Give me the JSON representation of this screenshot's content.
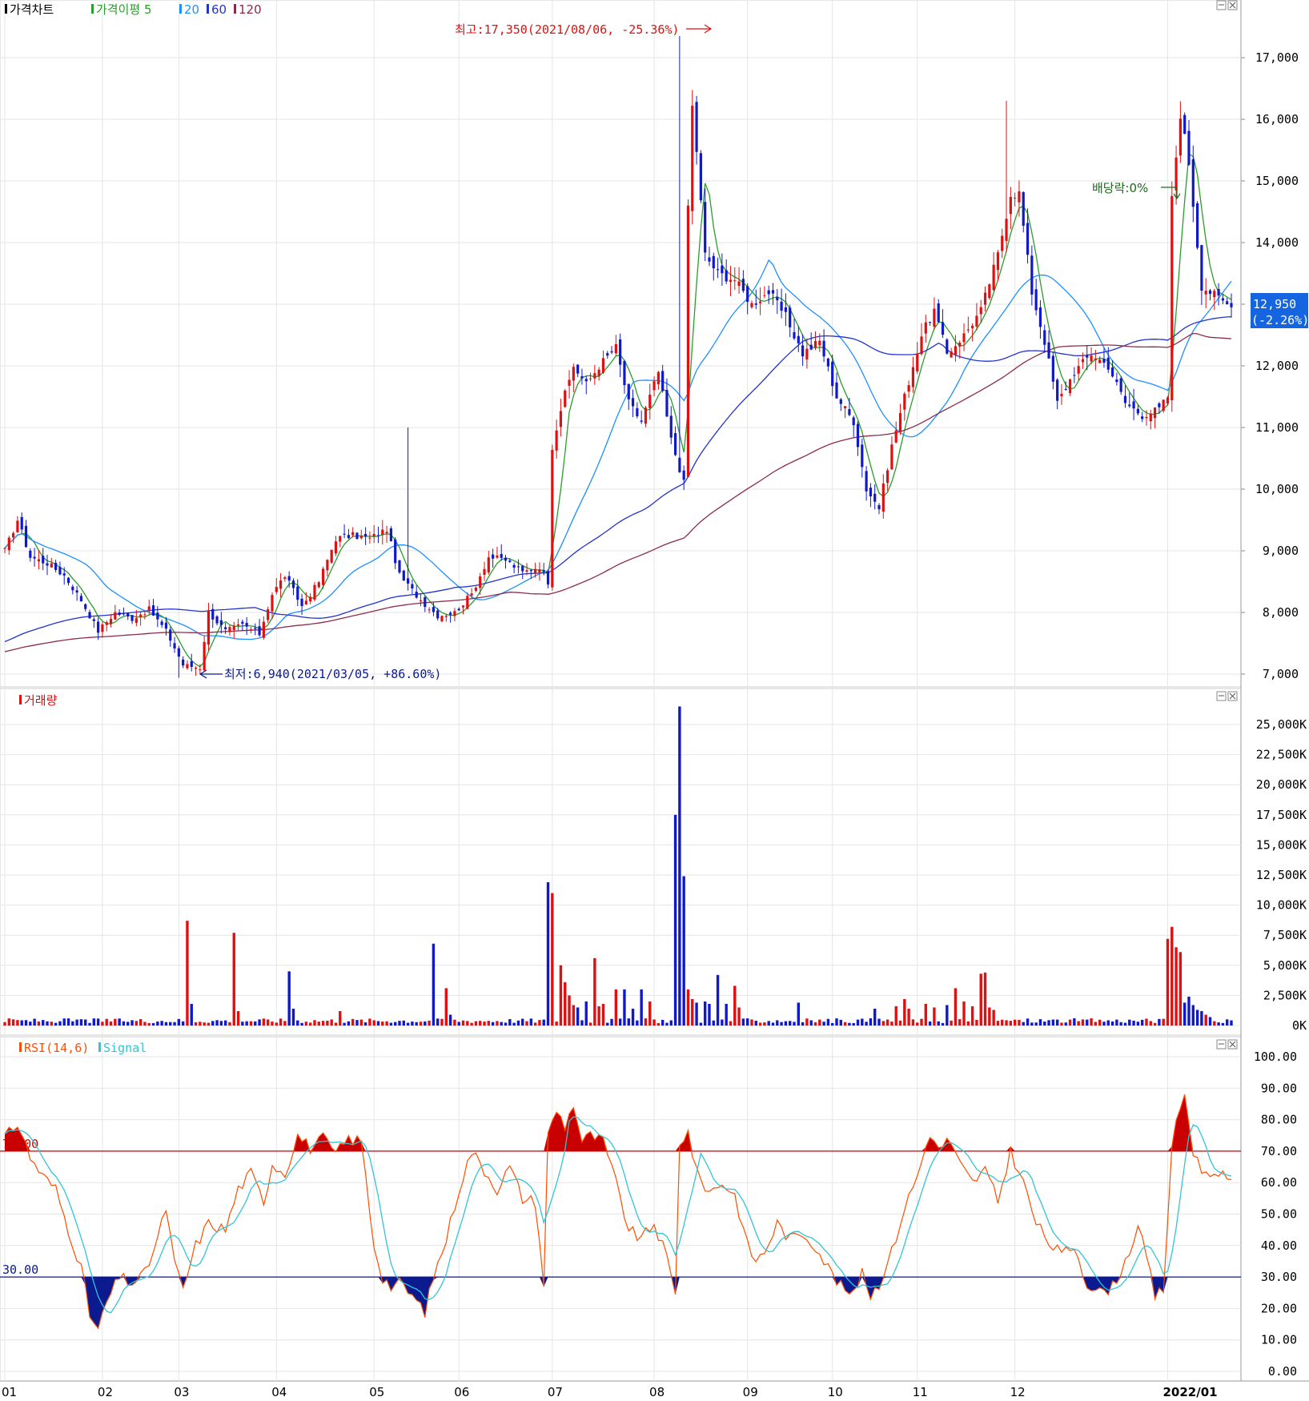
{
  "chart_data": [
    {
      "type": "candlestick",
      "legend": [
        {
          "label": "가격차트",
          "color": "#000000"
        },
        {
          "label": "가격이평 5",
          "color": "#2a9d2a"
        },
        {
          "label": "20",
          "color": "#1e90ff"
        },
        {
          "label": "60",
          "color": "#2233cc"
        },
        {
          "label": "120",
          "color": "#8b2b4a"
        }
      ],
      "ylim": [
        6600,
        17900
      ],
      "y_ticks": [
        "17,000",
        "16,000",
        "15,000",
        "14,000",
        "13,000",
        "12,000",
        "11,000",
        "10,000",
        "9,000",
        "8,000",
        "7,000"
      ],
      "y_tick_values": [
        17000,
        16000,
        15000,
        14000,
        13000,
        12000,
        11000,
        10000,
        9000,
        8000,
        7000
      ],
      "current_price": {
        "label": "12,950",
        "change": "(-2.26%)",
        "value": 12950
      },
      "annotations": [
        {
          "text": "최고:17,350(2021/08/06, -25.36%)",
          "value": 17350,
          "date": "2021/08/06"
        },
        {
          "text": "최저:6,940(2021/03/05, +86.60%)",
          "value": 6940,
          "date": "2021/03/05"
        },
        {
          "text": "배당락:0%",
          "date": "2021/12/29"
        }
      ],
      "price_anchors": [
        [
          0,
          9000
        ],
        [
          3,
          9500
        ],
        [
          6,
          8900
        ],
        [
          10,
          8800
        ],
        [
          14,
          8600
        ],
        [
          18,
          8200
        ],
        [
          22,
          7700
        ],
        [
          26,
          8000
        ],
        [
          30,
          7900
        ],
        [
          34,
          8050
        ],
        [
          38,
          7700
        ],
        [
          42,
          7150
        ],
        [
          46,
          7100
        ],
        [
          48,
          8000
        ],
        [
          52,
          7700
        ],
        [
          56,
          7800
        ],
        [
          60,
          7650
        ],
        [
          63,
          8300
        ],
        [
          66,
          8600
        ],
        [
          70,
          8100
        ],
        [
          74,
          8500
        ],
        [
          78,
          9200
        ],
        [
          82,
          9250
        ],
        [
          86,
          9200
        ],
        [
          90,
          9350
        ],
        [
          93,
          8600
        ],
        [
          98,
          8200
        ],
        [
          102,
          7950
        ],
        [
          106,
          8000
        ],
        [
          110,
          8300
        ],
        [
          114,
          8900
        ],
        [
          118,
          8850
        ],
        [
          122,
          8650
        ],
        [
          126,
          8750
        ],
        [
          128,
          8500
        ],
        [
          129,
          10700
        ],
        [
          131,
          11300
        ],
        [
          134,
          12000
        ],
        [
          137,
          11700
        ],
        [
          140,
          12000
        ],
        [
          144,
          12300
        ],
        [
          147,
          11400
        ],
        [
          150,
          11100
        ],
        [
          154,
          11900
        ],
        [
          157,
          10800
        ],
        [
          160,
          10100
        ],
        [
          161,
          14600
        ],
        [
          162,
          16200
        ],
        [
          163,
          15500
        ],
        [
          165,
          13800
        ],
        [
          168,
          13500
        ],
        [
          172,
          13400
        ],
        [
          176,
          13000
        ],
        [
          180,
          13200
        ],
        [
          184,
          12800
        ],
        [
          188,
          12200
        ],
        [
          192,
          12400
        ],
        [
          196,
          11500
        ],
        [
          200,
          11100
        ],
        [
          203,
          10000
        ],
        [
          206,
          9700
        ],
        [
          209,
          10700
        ],
        [
          212,
          11500
        ],
        [
          216,
          12500
        ],
        [
          219,
          12900
        ],
        [
          222,
          12200
        ],
        [
          226,
          12500
        ],
        [
          230,
          12900
        ],
        [
          234,
          13800
        ],
        [
          237,
          14800
        ],
        [
          239,
          14800
        ],
        [
          242,
          13200
        ],
        [
          245,
          12400
        ],
        [
          248,
          11400
        ],
        [
          252,
          11900
        ],
        [
          256,
          12200
        ],
        [
          260,
          12000
        ],
        [
          264,
          11400
        ],
        [
          268,
          11200
        ],
        [
          272,
          11300
        ],
        [
          274,
          11500
        ],
        [
          275,
          14700
        ],
        [
          277,
          16100
        ],
        [
          279,
          15300
        ],
        [
          282,
          13300
        ],
        [
          286,
          13100
        ],
        [
          289,
          12950
        ]
      ],
      "month_ticks": [
        {
          "label": "01",
          "index": 0
        },
        {
          "label": "02",
          "index": 23
        },
        {
          "label": "03",
          "index": 41
        },
        {
          "label": "04",
          "index": 64
        },
        {
          "label": "05",
          "index": 87
        },
        {
          "label": "06",
          "index": 107
        },
        {
          "label": "07",
          "index": 129
        },
        {
          "label": "08",
          "index": 153
        },
        {
          "label": "09",
          "index": 175
        },
        {
          "label": "10",
          "index": 195
        },
        {
          "label": "11",
          "index": 215
        },
        {
          "label": "12",
          "index": 238
        },
        {
          "label": "2022/01",
          "index": 274
        }
      ],
      "total_days": 290
    },
    {
      "type": "bar",
      "legend": [
        {
          "label": "거래량",
          "color": "#dd1111"
        }
      ],
      "ylim": [
        0,
        26500
      ],
      "y_ticks": [
        "25,000K",
        "22,500K",
        "20,000K",
        "17,500K",
        "15,000K",
        "12,500K",
        "10,000K",
        "7,500K",
        "5,000K",
        "2,500K",
        "0K"
      ],
      "y_tick_values": [
        25000,
        22500,
        20000,
        17500,
        15000,
        12500,
        10000,
        7500,
        5000,
        2500,
        0
      ],
      "base_volume": 400,
      "volume_spikes": [
        [
          43,
          8700
        ],
        [
          44,
          1800
        ],
        [
          54,
          7700
        ],
        [
          55,
          1200
        ],
        [
          67,
          4500
        ],
        [
          68,
          1400
        ],
        [
          79,
          1200
        ],
        [
          101,
          6800
        ],
        [
          104,
          3100
        ],
        [
          105,
          900
        ],
        [
          128,
          11900
        ],
        [
          129,
          11000
        ],
        [
          131,
          5000
        ],
        [
          132,
          3600
        ],
        [
          133,
          2500
        ],
        [
          134,
          1700
        ],
        [
          135,
          1500
        ],
        [
          137,
          2000
        ],
        [
          139,
          5600
        ],
        [
          140,
          1600
        ],
        [
          141,
          1800
        ],
        [
          144,
          3000
        ],
        [
          146,
          3000
        ],
        [
          148,
          1400
        ],
        [
          150,
          3000
        ],
        [
          152,
          2000
        ],
        [
          158,
          17500
        ],
        [
          159,
          26500
        ],
        [
          160,
          12400
        ],
        [
          161,
          3000
        ],
        [
          162,
          2200
        ],
        [
          163,
          1900
        ],
        [
          165,
          2000
        ],
        [
          166,
          1800
        ],
        [
          168,
          4200
        ],
        [
          170,
          1800
        ],
        [
          172,
          3300
        ],
        [
          173,
          1500
        ],
        [
          187,
          1900
        ],
        [
          205,
          1400
        ],
        [
          210,
          1600
        ],
        [
          212,
          2200
        ],
        [
          213,
          1400
        ],
        [
          217,
          1800
        ],
        [
          219,
          1500
        ],
        [
          222,
          1700
        ],
        [
          224,
          3100
        ],
        [
          226,
          2000
        ],
        [
          228,
          1600
        ],
        [
          230,
          4300
        ],
        [
          231,
          4400
        ],
        [
          232,
          1500
        ],
        [
          233,
          1300
        ],
        [
          274,
          7200
        ],
        [
          275,
          8200
        ],
        [
          276,
          6500
        ],
        [
          277,
          6100
        ],
        [
          278,
          1900
        ],
        [
          279,
          2400
        ],
        [
          280,
          1700
        ],
        [
          281,
          1300
        ],
        [
          282,
          1200
        ],
        [
          283,
          900
        ],
        [
          284,
          700
        ]
      ]
    },
    {
      "type": "line",
      "legend": [
        {
          "label": "RSI(14,6)",
          "color": "#ff4d00"
        },
        {
          "label": "Signal",
          "color": "#33c4d4"
        }
      ],
      "ylim": [
        0,
        100
      ],
      "y_ticks": [
        "100.00",
        "90.00",
        "80.00",
        "70.00",
        "60.00",
        "50.00",
        "40.00",
        "30.00",
        "20.00",
        "10.00",
        "0.00"
      ],
      "y_tick_values": [
        100,
        90,
        80,
        70,
        60,
        50,
        40,
        30,
        20,
        10,
        0
      ],
      "levels": [
        {
          "label": "70.00",
          "value": 70,
          "color": "#cc0000"
        },
        {
          "label": "30.00",
          "value": 30,
          "color": "#0b1a8f"
        }
      ],
      "rsi_anchors": [
        [
          0,
          74
        ],
        [
          3,
          79
        ],
        [
          6,
          68
        ],
        [
          9,
          62
        ],
        [
          12,
          58
        ],
        [
          15,
          45
        ],
        [
          18,
          33
        ],
        [
          20,
          18
        ],
        [
          22,
          13
        ],
        [
          24,
          22
        ],
        [
          27,
          30
        ],
        [
          30,
          28
        ],
        [
          33,
          31
        ],
        [
          36,
          42
        ],
        [
          38,
          52
        ],
        [
          40,
          34
        ],
        [
          42,
          26
        ],
        [
          45,
          40
        ],
        [
          48,
          47
        ],
        [
          52,
          45
        ],
        [
          55,
          58
        ],
        [
          58,
          63
        ],
        [
          61,
          54
        ],
        [
          63,
          66
        ],
        [
          66,
          63
        ],
        [
          69,
          75
        ],
        [
          72,
          71
        ],
        [
          75,
          74
        ],
        [
          78,
          69
        ],
        [
          81,
          74
        ],
        [
          84,
          73
        ],
        [
          87,
          40
        ],
        [
          89,
          30
        ],
        [
          91,
          27
        ],
        [
          93,
          28
        ],
        [
          96,
          24
        ],
        [
          99,
          19
        ],
        [
          101,
          30
        ],
        [
          104,
          42
        ],
        [
          107,
          58
        ],
        [
          110,
          70
        ],
        [
          113,
          64
        ],
        [
          116,
          58
        ],
        [
          119,
          65
        ],
        [
          122,
          55
        ],
        [
          125,
          54
        ],
        [
          127,
          28
        ],
        [
          128,
          75
        ],
        [
          130,
          83
        ],
        [
          132,
          78
        ],
        [
          134,
          85
        ],
        [
          136,
          73
        ],
        [
          138,
          75
        ],
        [
          141,
          73
        ],
        [
          144,
          60
        ],
        [
          147,
          45
        ],
        [
          150,
          42
        ],
        [
          153,
          47
        ],
        [
          156,
          36
        ],
        [
          158,
          24
        ],
        [
          159,
          73
        ],
        [
          161,
          76
        ],
        [
          163,
          63
        ],
        [
          166,
          57
        ],
        [
          169,
          60
        ],
        [
          172,
          56
        ],
        [
          175,
          40
        ],
        [
          177,
          35
        ],
        [
          179,
          38
        ],
        [
          182,
          47
        ],
        [
          185,
          42
        ],
        [
          188,
          44
        ],
        [
          191,
          40
        ],
        [
          194,
          33
        ],
        [
          197,
          27
        ],
        [
          200,
          24
        ],
        [
          202,
          33
        ],
        [
          204,
          24
        ],
        [
          206,
          28
        ],
        [
          209,
          38
        ],
        [
          212,
          52
        ],
        [
          215,
          62
        ],
        [
          218,
          76
        ],
        [
          220,
          70
        ],
        [
          222,
          74
        ],
        [
          225,
          66
        ],
        [
          228,
          60
        ],
        [
          231,
          64
        ],
        [
          234,
          54
        ],
        [
          237,
          70
        ],
        [
          240,
          60
        ],
        [
          243,
          47
        ],
        [
          246,
          41
        ],
        [
          249,
          37
        ],
        [
          252,
          40
        ],
        [
          255,
          28
        ],
        [
          258,
          25
        ],
        [
          261,
          27
        ],
        [
          264,
          35
        ],
        [
          267,
          46
        ],
        [
          269,
          36
        ],
        [
          271,
          24
        ],
        [
          273,
          26
        ],
        [
          275,
          72
        ],
        [
          277,
          84
        ],
        [
          278,
          88
        ],
        [
          280,
          70
        ],
        [
          283,
          62
        ],
        [
          286,
          64
        ],
        [
          289,
          59
        ]
      ],
      "month_ticks": [
        "01",
        "02",
        "03",
        "04",
        "05",
        "06",
        "07",
        "08",
        "09",
        "10",
        "11",
        "12",
        "2022/01"
      ]
    }
  ]
}
